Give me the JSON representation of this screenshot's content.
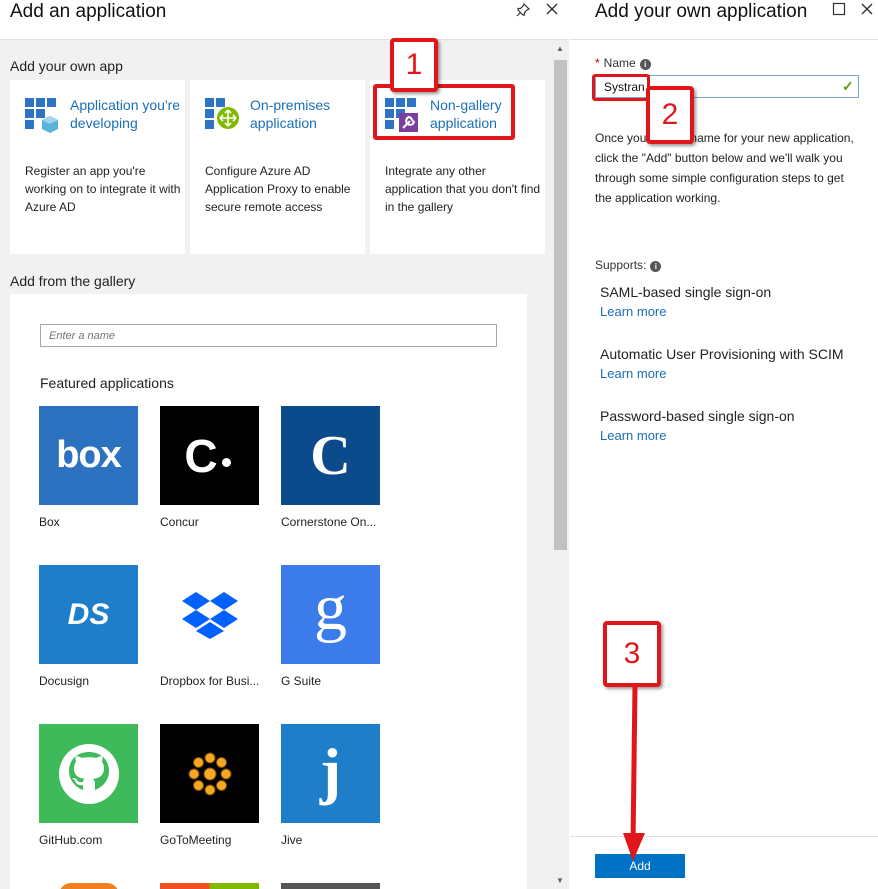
{
  "left_blade": {
    "title": "Add an application",
    "own_app_section": "Add your own app",
    "tiles": [
      {
        "title": "Application you're developing",
        "icon": "app-developing-icon",
        "description": "Register an app you're working on to integrate it with Azure AD"
      },
      {
        "title": "On-premises application",
        "icon": "app-proxy-icon",
        "description": "Configure Azure AD Application Proxy to enable secure remote access"
      },
      {
        "title": "Non-gallery application",
        "icon": "non-gallery-icon",
        "description": "Integrate any other application that you don't find in the gallery"
      }
    ],
    "gallery_section": "Add from the gallery",
    "search_placeholder": "Enter a name",
    "featured_label": "Featured applications",
    "apps": [
      {
        "name": "Box",
        "color": "#2c72c0"
      },
      {
        "name": "Concur",
        "color": "#000000"
      },
      {
        "name": "Cornerstone On...",
        "color": "#0b4a8b"
      },
      {
        "name": "Docusign",
        "color": "#1f7ec9"
      },
      {
        "name": "Dropbox for Busi...",
        "color": "#ffffff"
      },
      {
        "name": "G Suite",
        "color": "#3b7cea"
      },
      {
        "name": "GitHub.com",
        "color": "#3fba5a"
      },
      {
        "name": "GoToMeeting",
        "color": "#000000"
      },
      {
        "name": "Jive",
        "color": "#1f7ec9"
      }
    ],
    "logo_text": {
      "box": "box",
      "concur": "C",
      "cornerstone": "C",
      "docusign": "DS",
      "gsuite": "g",
      "jive": "j"
    }
  },
  "right_blade": {
    "title": "Add your own application",
    "name_label": "Name",
    "name_value": "Systran",
    "description": "Once you enter a name for your new application, click the \"Add\" button below and we'll walk you through some simple configuration steps to get the application working.",
    "supports_label": "Supports:",
    "features": [
      {
        "name": "SAML-based single sign-on",
        "link": "Learn more"
      },
      {
        "name": "Automatic User Provisioning with SCIM",
        "link": "Learn more"
      },
      {
        "name": "Password-based single sign-on",
        "link": "Learn more"
      }
    ],
    "add_label": "Add"
  },
  "annotations": {
    "step1": "1",
    "step2": "2",
    "step3": "3"
  },
  "colors": {
    "accent": "#0072c6",
    "link": "#1a6fb5",
    "annotation": "#e0161b",
    "success": "#5ba000"
  }
}
